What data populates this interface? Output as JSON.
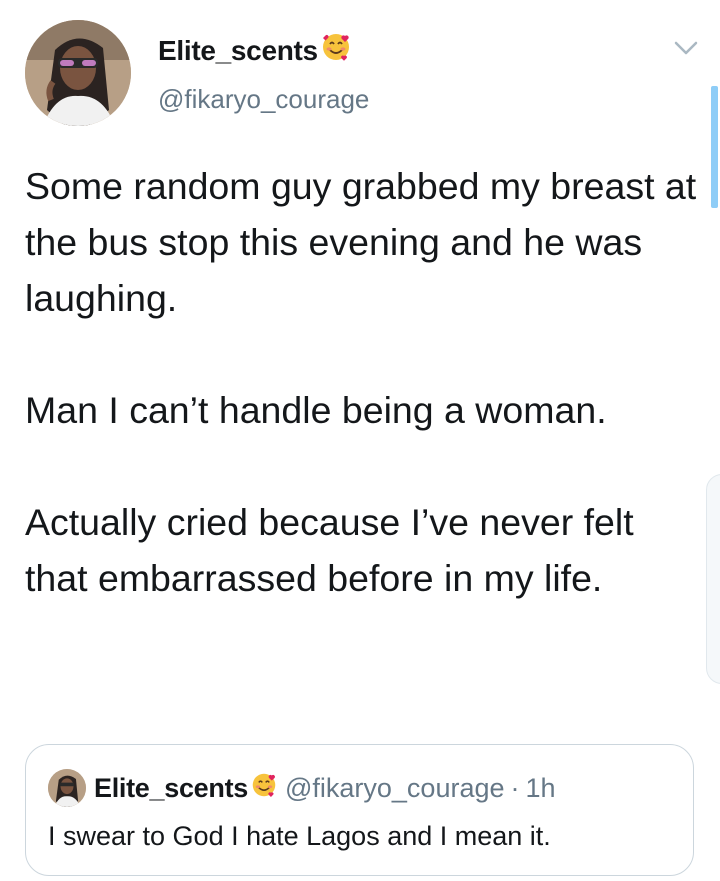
{
  "author": {
    "display_name": "Elite_scents",
    "name_emoji": "smiling-face-with-hearts-icon",
    "handle": "@fikaryo_courage"
  },
  "tweet": {
    "paragraphs": [
      "Some random guy grabbed my breast at the bus stop this evening and he was laughing.",
      "Man I can’t handle being a woman.",
      "Actually cried because I’ve never felt that embarrassed before in my life."
    ]
  },
  "quoted_tweet": {
    "display_name": "Elite_scents",
    "handle": "@fikaryo_courage",
    "separator": "·",
    "time": "1h",
    "text": "I swear to God I hate Lagos and I mean it."
  },
  "icons": {
    "menu": "chevron-down-icon"
  },
  "colors": {
    "text": "#14171a",
    "secondary": "#657786",
    "border": "#ccd6dd",
    "accent": "#8ecdf7"
  }
}
